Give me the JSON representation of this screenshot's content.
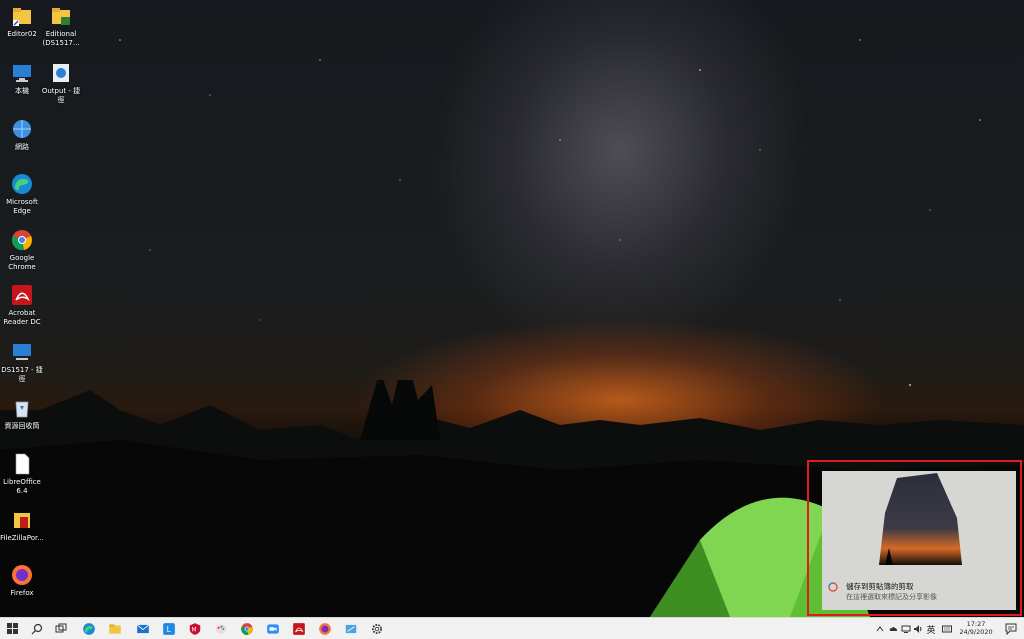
{
  "desktop_icons": [
    {
      "label": "Editor02",
      "icon": "folder-shortcut-icon"
    },
    {
      "label": "Editional\n(DS1517...",
      "icon": "folder-shortcut-icon"
    },
    {
      "label": "本機",
      "icon": "this-pc-icon"
    },
    {
      "label": "Output - 捷\n徑",
      "icon": "network-folder-icon"
    },
    {
      "label": "網路",
      "icon": "network-icon"
    },
    {
      "label": "Microsoft\nEdge",
      "icon": "edge-icon"
    },
    {
      "label": "Google\nChrome",
      "icon": "chrome-icon"
    },
    {
      "label": "Acrobat\nReader DC",
      "icon": "acrobat-icon"
    },
    {
      "label": "DS1517 - 捷\n徑",
      "icon": "computer-shortcut-icon"
    },
    {
      "label": "資源回收筒",
      "icon": "recycle-bin-icon"
    },
    {
      "label": "LibreOffice\n6.4",
      "icon": "libreoffice-icon"
    },
    {
      "label": "FileZillaPor...",
      "icon": "filezilla-icon"
    },
    {
      "label": "Firefox",
      "icon": "firefox-icon"
    }
  ],
  "toast": {
    "title": "儲存到剪貼簿的剪取",
    "subtitle": "在這裡選取來標記及分享影像",
    "app_icon": "snip-sketch-icon"
  },
  "taskbar": {
    "apps": [
      "start-icon",
      "search-icon",
      "task-view-icon",
      "edge-icon",
      "file-explorer-icon",
      "mail-icon",
      "line-icon",
      "mcafee-icon",
      "paint-icon",
      "chrome-icon",
      "zoom-icon",
      "acrobat-icon",
      "firefox-icon",
      "snip-icon",
      "settings-icon"
    ],
    "tray_input_indicator": "英",
    "time": "17:27",
    "date": "24/9/2020"
  }
}
